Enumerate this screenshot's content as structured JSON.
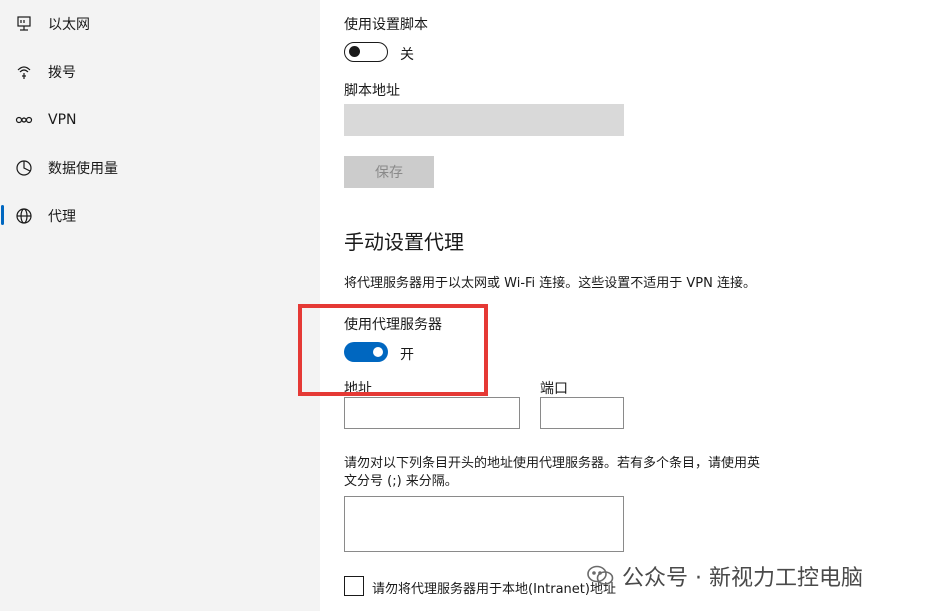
{
  "sidebar": {
    "items": [
      {
        "icon": "ethernet-icon",
        "label": "以太网"
      },
      {
        "icon": "dialup-icon",
        "label": "拨号"
      },
      {
        "icon": "vpn-icon",
        "label": "VPN"
      },
      {
        "icon": "data-usage-icon",
        "label": "数据使用量"
      },
      {
        "icon": "globe-icon",
        "label": "代理",
        "active": true
      }
    ]
  },
  "script_section": {
    "use_script_label": "使用设置脚本",
    "toggle_state": "关",
    "script_address_label": "脚本地址",
    "save_label": "保存"
  },
  "manual_section": {
    "heading": "手动设置代理",
    "description": "将代理服务器用于以太网或 Wi-Fi 连接。这些设置不适用于 VPN 连接。",
    "use_proxy_label": "使用代理服务器",
    "toggle_state": "开",
    "address_label": "地址",
    "port_label": "端口",
    "exceptions_line1": "请勿对以下列条目开头的地址使用代理服务器。若有多个条目，请使用英",
    "exceptions_line2": "文分号 (;) 来分隔。",
    "local_checkbox_label": "请勿将代理服务器用于本地(Intranet)地址"
  },
  "watermark": {
    "text": "公众号 · 新视力工控电脑"
  },
  "colors": {
    "accent": "#0067c0",
    "highlight": "#e53935"
  }
}
